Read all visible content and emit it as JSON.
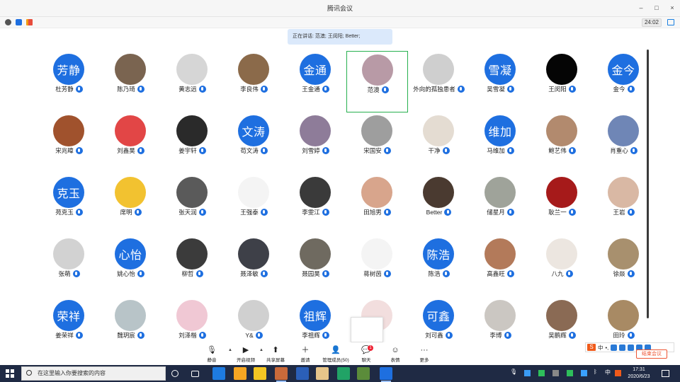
{
  "window": {
    "title": "腾讯会议"
  },
  "window_controls": {
    "min": "–",
    "max": "□",
    "close": "×"
  },
  "infobar": {
    "timer": "24:02"
  },
  "speaking": {
    "text": "正在讲话: 范澳; 王闵阳; Better;"
  },
  "participants": [
    {
      "name": "杜芳静",
      "avatar": "芳静",
      "color": "#1e6fe0",
      "active": false
    },
    {
      "name": "陈乃琦",
      "avatar": "",
      "color": "#7a6450",
      "active": false
    },
    {
      "name": "黄志远",
      "avatar": "",
      "color": "#d6d6d6",
      "active": false
    },
    {
      "name": "李良伟",
      "avatar": "",
      "color": "#8b6a4a",
      "active": false
    },
    {
      "name": "王金通",
      "avatar": "金通",
      "color": "#1e6fe0",
      "active": false
    },
    {
      "name": "范澳",
      "avatar": "",
      "color": "#b89aa6",
      "active": true
    },
    {
      "name": "外向的孤独患者",
      "avatar": "",
      "color": "#cfcfcf",
      "active": false
    },
    {
      "name": "吴雪凝",
      "avatar": "雪凝",
      "color": "#1e6fe0",
      "active": false
    },
    {
      "name": "王闵阳",
      "avatar": "",
      "color": "#050505",
      "active": false
    },
    {
      "name": "金今",
      "avatar": "金今",
      "color": "#1e6fe0",
      "active": false
    },
    {
      "name": "宋兆暐",
      "avatar": "",
      "color": "#a0522d",
      "active": false
    },
    {
      "name": "刘鑫昊",
      "avatar": "",
      "color": "#e24646",
      "active": false
    },
    {
      "name": "姜宇轩",
      "avatar": "",
      "color": "#2a2a2a",
      "active": false
    },
    {
      "name": "苟文涛",
      "avatar": "文涛",
      "color": "#1e6fe0",
      "active": false
    },
    {
      "name": "刘雪婷",
      "avatar": "",
      "color": "#8e7c99",
      "active": false
    },
    {
      "name": "宋国安",
      "avatar": "",
      "color": "#9e9e9e",
      "active": false
    },
    {
      "name": "干净",
      "avatar": "",
      "color": "#e4dcd2",
      "active": false
    },
    {
      "name": "马维加",
      "avatar": "维加",
      "color": "#1e6fe0",
      "active": false
    },
    {
      "name": "鲍艺伟",
      "avatar": "",
      "color": "#b28a6e",
      "active": false
    },
    {
      "name": "肖重心",
      "avatar": "",
      "color": "#6f86b6",
      "active": false
    },
    {
      "name": "苑克玉",
      "avatar": "克玉",
      "color": "#1e6fe0",
      "active": false
    },
    {
      "name": "席明",
      "avatar": "",
      "color": "#f2c230",
      "active": false
    },
    {
      "name": "张天润",
      "avatar": "",
      "color": "#5a5a5a",
      "active": false
    },
    {
      "name": "王强泰",
      "avatar": "",
      "color": "#f4f4f4",
      "active": false
    },
    {
      "name": "李雯江",
      "avatar": "",
      "color": "#3a3a3a",
      "active": false
    },
    {
      "name": "田旭男",
      "avatar": "",
      "color": "#d8a58c",
      "active": false
    },
    {
      "name": "Better",
      "avatar": "",
      "color": "#4a3a30",
      "active": false
    },
    {
      "name": "储星月",
      "avatar": "",
      "color": "#9fa39a",
      "active": false
    },
    {
      "name": "耿兰一",
      "avatar": "",
      "color": "#a61a1a",
      "active": false
    },
    {
      "name": "王岩",
      "avatar": "",
      "color": "#d9b8a4",
      "active": false
    },
    {
      "name": "张萌",
      "avatar": "",
      "color": "#d2d2d2",
      "active": false
    },
    {
      "name": "姚心怡",
      "avatar": "心怡",
      "color": "#1e6fe0",
      "active": false
    },
    {
      "name": "柳哲",
      "avatar": "",
      "color": "#3b3b3b",
      "active": false
    },
    {
      "name": "聂泽敏",
      "avatar": "",
      "color": "#3e4048",
      "active": false
    },
    {
      "name": "聂园昊",
      "avatar": "",
      "color": "#6f6a60",
      "active": false
    },
    {
      "name": "蒋树茵",
      "avatar": "",
      "color": "#f4f4f4",
      "active": false
    },
    {
      "name": "陈浩",
      "avatar": "陈浩",
      "color": "#1e6fe0",
      "active": false
    },
    {
      "name": "高鑫旺",
      "avatar": "",
      "color": "#b37a5a",
      "active": false
    },
    {
      "name": "八九",
      "avatar": "",
      "color": "#ece6e0",
      "active": false
    },
    {
      "name": "徐燚",
      "avatar": "",
      "color": "#a8906e",
      "active": false
    },
    {
      "name": "姜荣祥",
      "avatar": "荣祥",
      "color": "#1e6fe0",
      "active": false
    },
    {
      "name": "魏玥宸",
      "avatar": "",
      "color": "#b8c4c8",
      "active": false
    },
    {
      "name": "刘泽楷",
      "avatar": "",
      "color": "#f0c8d4",
      "active": false
    },
    {
      "name": "Y&",
      "avatar": "",
      "color": "#d0d0d0",
      "active": false
    },
    {
      "name": "李祖辉",
      "avatar": "祖辉",
      "color": "#1e6fe0",
      "active": false
    },
    {
      "name": "",
      "avatar": "",
      "color": "#f2dede",
      "active": false
    },
    {
      "name": "刘可鑫",
      "avatar": "可鑫",
      "color": "#1e6fe0",
      "active": false
    },
    {
      "name": "李博",
      "avatar": "",
      "color": "#cbc7c2",
      "active": false
    },
    {
      "name": "吴鹏辉",
      "avatar": "",
      "color": "#8a6a54",
      "active": false
    },
    {
      "name": "田玲",
      "avatar": "",
      "color": "#a88a64",
      "active": false
    }
  ],
  "toolbar": {
    "items": [
      {
        "label": "静音",
        "icon": "🎙"
      },
      {
        "label": "开启视频",
        "icon": "▶"
      },
      {
        "label": "共享屏幕",
        "icon": "⬆"
      },
      {
        "label": "邀请",
        "icon": "＋"
      },
      {
        "label": "管理成员(50)",
        "icon": "👤"
      },
      {
        "label": "聊天",
        "icon": "💬"
      },
      {
        "label": "表情",
        "icon": "☺"
      },
      {
        "label": "更多",
        "icon": "···"
      }
    ],
    "chat_badge": "1",
    "end_meeting": "结束会议"
  },
  "ime": {
    "logo": "S",
    "lang": "中",
    "punct": "•,"
  },
  "taskbar": {
    "search_placeholder": "在这里输入你要搜索的内容",
    "time": "17:31",
    "date": "2020/6/23",
    "input_lang": "中"
  },
  "colors": {
    "accent": "#1e6fe0",
    "active_border": "#27b04f",
    "taskbar": "#1f2a44",
    "banner": "#dbe9fb"
  }
}
